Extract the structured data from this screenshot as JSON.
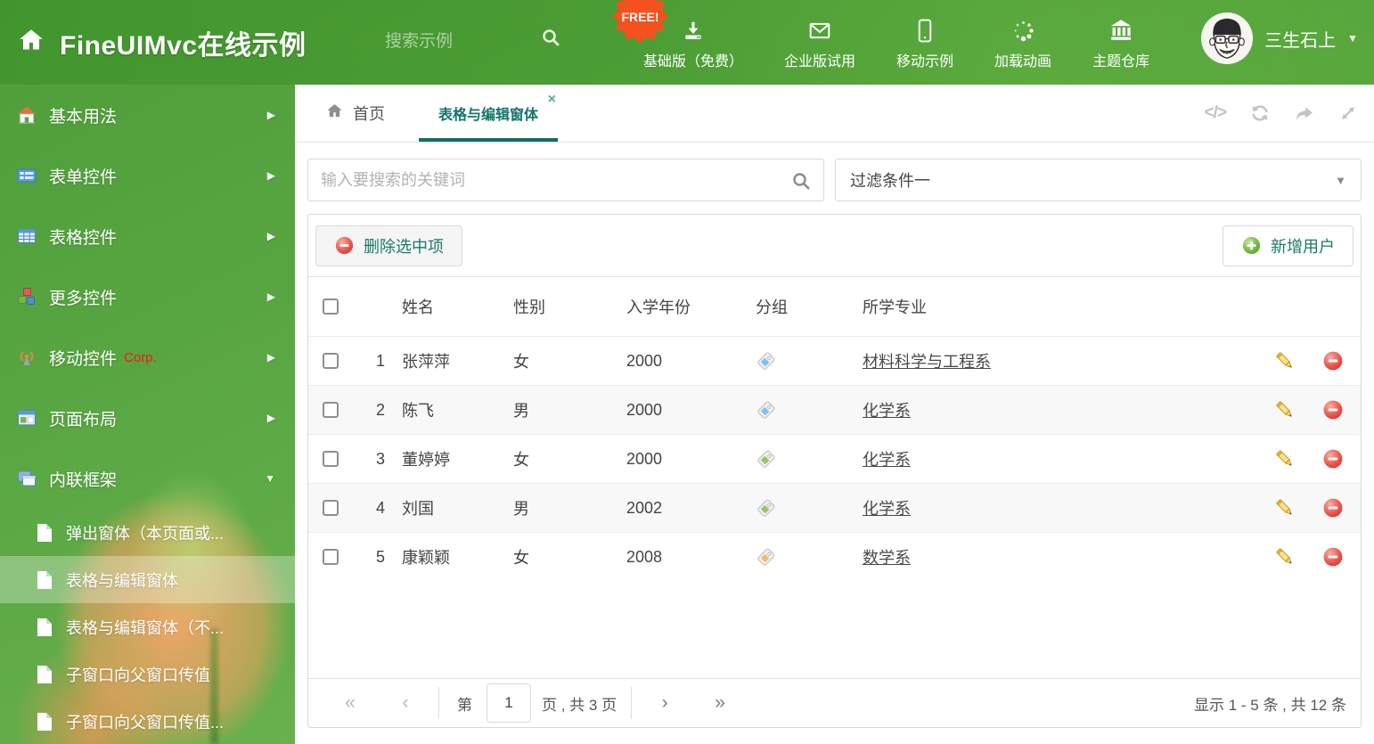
{
  "header": {
    "title": "FineUIMvc在线示例",
    "search_placeholder": "搜索示例",
    "free_badge": "FREE!",
    "nav": [
      {
        "label": "基础版（免费）"
      },
      {
        "label": "企业版试用"
      },
      {
        "label": "移动示例"
      },
      {
        "label": "加载动画"
      },
      {
        "label": "主题仓库"
      }
    ],
    "user_name": "三生石上"
  },
  "sidebar": {
    "items": [
      {
        "label": "基本用法"
      },
      {
        "label": "表单控件"
      },
      {
        "label": "表格控件"
      },
      {
        "label": "更多控件"
      },
      {
        "label": "移动控件",
        "badge": "Corp."
      },
      {
        "label": "页面布局"
      },
      {
        "label": "内联框架"
      }
    ],
    "subitems": [
      {
        "label": "弹出窗体（本页面或..."
      },
      {
        "label": "表格与编辑窗体"
      },
      {
        "label": "表格与编辑窗体（不..."
      },
      {
        "label": "子窗口向父窗口传值"
      },
      {
        "label": "子窗口向父窗口传值..."
      }
    ]
  },
  "tabs": {
    "home": "首页",
    "active": "表格与编辑窗体"
  },
  "filter": {
    "search_placeholder": "输入要搜索的关键词",
    "selected": "过滤条件一"
  },
  "grid": {
    "delete_button": "删除选中项",
    "add_button": "新增用户",
    "columns": [
      "姓名",
      "性别",
      "入学年份",
      "分组",
      "所学专业"
    ],
    "rows": [
      {
        "num": "1",
        "name": "张萍萍",
        "gender": "女",
        "year": "2000",
        "tag_color": "#7fc3f0",
        "major": "材料科学与工程系"
      },
      {
        "num": "2",
        "name": "陈飞",
        "gender": "男",
        "year": "2000",
        "tag_color": "#7fc3f0",
        "major": "化学系"
      },
      {
        "num": "3",
        "name": "董婷婷",
        "gender": "女",
        "year": "2000",
        "tag_color": "#97c766",
        "major": "化学系"
      },
      {
        "num": "4",
        "name": "刘国",
        "gender": "男",
        "year": "2002",
        "tag_color": "#97c766",
        "major": "化学系"
      },
      {
        "num": "5",
        "name": "康颖颖",
        "gender": "女",
        "year": "2008",
        "tag_color": "#f6b871",
        "major": "数学系"
      }
    ]
  },
  "pagination": {
    "first": "«",
    "prev": "‹",
    "next": "›",
    "last": "»",
    "label_prefix": "第",
    "page": "1",
    "label_suffix": "页 , 共 3 页",
    "summary": "显示 1 - 5 条 , 共 12 条"
  },
  "glyphs": {
    "arrow_right": "▶",
    "arrow_down": "▼",
    "caret_down": "▼",
    "close": "×",
    "code": "</>"
  },
  "colors": {
    "accent_teal": "#15756a",
    "header_green": "#4a9c35",
    "badge_orange": "#f4511e",
    "corp_red": "#ff1414"
  }
}
